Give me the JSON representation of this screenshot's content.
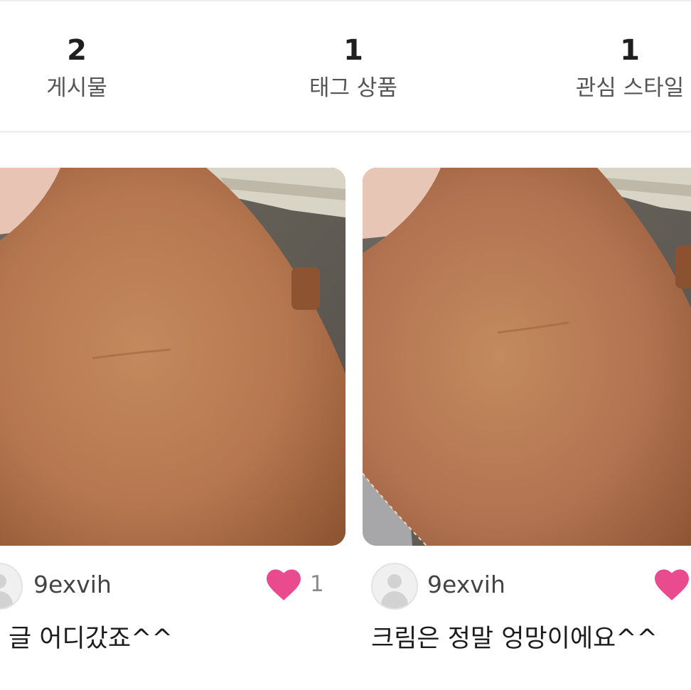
{
  "stats": {
    "posts": {
      "count": "2",
      "label": "게시물"
    },
    "tagged_products": {
      "count": "1",
      "label": "태그 상품"
    },
    "liked_styles": {
      "count": "1",
      "label": "관심 스타일"
    }
  },
  "posts": [
    {
      "username": "9exvih",
      "likes": "1",
      "caption": "글 어디갔죠^^",
      "photo_subject": "brown-leather-bag-photo"
    },
    {
      "username": "9exvih",
      "likes": "",
      "caption": "크림은 정말 엉망이에요^^",
      "photo_subject": "brown-leather-bag-photo"
    }
  ],
  "colors": {
    "heart": "#ea4a8e",
    "leather": "#b87a4f",
    "divider": "#efefef"
  }
}
